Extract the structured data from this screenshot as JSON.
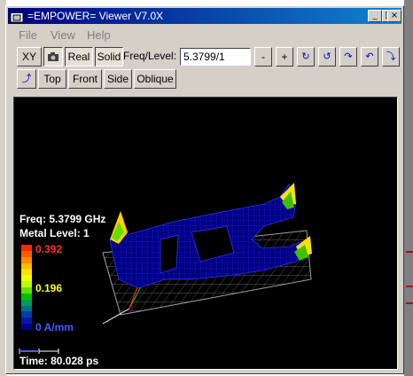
{
  "window": {
    "title": "=EMPOWER= Viewer V7.0X",
    "controls": {
      "minimize": "_",
      "maximize": "□",
      "close": "×"
    }
  },
  "menu": {
    "items": [
      "File",
      "View",
      "Help"
    ]
  },
  "toolbar": {
    "xy_label": "XY",
    "real_label": "Real",
    "solid_label": "Solid",
    "freq_label": "Freq/Level:",
    "freq_value": "5.3799/1",
    "minus_label": "-",
    "plus_label": "+",
    "top_label": "Top",
    "front_label": "Front",
    "side_label": "Side",
    "oblique_label": "Oblique"
  },
  "icons": {
    "app": "app-icon",
    "camera": "camera-icon",
    "rotate": [
      "rotate-cw-icon",
      "rotate-ccw-icon",
      "rotate-right-icon",
      "rotate-left-icon",
      "rotate-down-icon",
      "rotate-up-icon"
    ]
  },
  "viewport": {
    "freq_text": "Freq: 5.3799 GHz",
    "metal_text": "Metal Level: 1",
    "time_text": "Time: 80.028 ps",
    "colorbar": {
      "max_label": "0.392",
      "mid_label": "0.196",
      "min_label": "0 A/mm",
      "max_value": 0.392,
      "mid_value": 0.196,
      "min_value": 0,
      "colors": [
        "#ff2a00",
        "#ff5a00",
        "#ff8a00",
        "#ffb800",
        "#ffe000",
        "#f0ff00",
        "#b8ff00",
        "#60e000",
        "#00c000",
        "#009a60",
        "#00708a",
        "#0040a0",
        "#0018b0",
        "#000090"
      ]
    },
    "colors": {
      "max_label": "#ff3030",
      "mid_label": "#ffff00",
      "min_label": "#4060ff"
    }
  }
}
